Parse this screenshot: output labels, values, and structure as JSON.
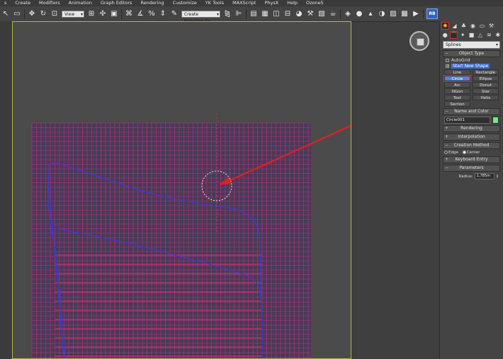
{
  "menu": [
    "s",
    "Create",
    "Modifiers",
    "Animation",
    "Graph Editors",
    "Rendering",
    "Customize",
    "YK Tools",
    "MAXScript",
    "PhysX",
    "Help",
    "Ozone5"
  ],
  "toolbar": {
    "view_dropdown": "View",
    "selection_set_dropdown": "Create Selection Se",
    "rb_label": "RB"
  },
  "command_panel": {
    "category_dropdown": "Splines",
    "object_type": {
      "header": "Object Type",
      "autogrid_label": "AutoGrid",
      "start_new_shape_label": "Start New Shape",
      "start_new_shape_checked": true,
      "buttons": [
        "Line",
        "Rectangle",
        "Circle",
        "Ellipse",
        "Arc",
        "Donut",
        "NGon",
        "Star",
        "Text",
        "Helix",
        "Section"
      ],
      "active_button": "Circle"
    },
    "name_and_color": {
      "header": "Name and Color",
      "name_value": "Circle001",
      "color": "#7be38a"
    },
    "rollouts": {
      "rendering": "Rendering",
      "interpolation": "Interpolation",
      "creation_method": "Creation Method",
      "edge_label": "Edge",
      "center_label": "Center",
      "selected_method": "Center",
      "keyboard_entry": "Keyboard Entry",
      "parameters": "Parameters",
      "radius_label": "Radius:",
      "radius_value": "1,785m"
    }
  },
  "colors": {
    "grid_line": "#b4329a",
    "shape_outline": "#3a3ad8",
    "annotation_arrow": "#e02020",
    "viewport_border": "#b7b24a",
    "accent_blue": "#5b7fd0"
  }
}
